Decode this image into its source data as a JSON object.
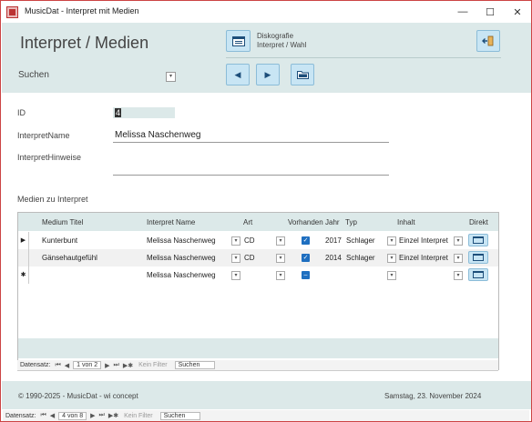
{
  "window": {
    "title": "MusicDat - Interpret mit Medien",
    "min_glyph": "—",
    "max_glyph": "☐",
    "close_glyph": "✕"
  },
  "header": {
    "title": "Interpret / Medien",
    "search_label": "Suchen",
    "disco_line1": "Diskografie",
    "disco_line2": "Interpret / Wahl"
  },
  "form": {
    "id_label": "ID",
    "id_value": "4",
    "name_label": "InterpretName",
    "name_value": "Melissa Naschenweg",
    "hint_label": "InterpretHinweise",
    "hint_value": "",
    "media_label": "Medien zu Interpret"
  },
  "subform": {
    "columns": [
      "Medium Titel",
      "Interpret Name",
      "Art",
      "Vorhanden",
      "Jahr",
      "Typ",
      "Inhalt",
      "Direkt"
    ],
    "rows": [
      {
        "selector": "▶",
        "titel": "Kunterbunt",
        "interpret": "Melissa Naschenweg",
        "art": "CD",
        "vorhanden": true,
        "jahr": "2017",
        "typ": "Schlager",
        "inhalt": "Einzel Interpret"
      },
      {
        "selector": "",
        "titel": "Gänsehautgefühl",
        "interpret": "Melissa Naschenweg",
        "art": "CD",
        "vorhanden": true,
        "jahr": "2014",
        "typ": "Schlager",
        "inhalt": "Einzel Interpret"
      },
      {
        "selector": "✱",
        "titel": "",
        "interpret": "Melissa Naschenweg",
        "art": "",
        "vorhanden": false,
        "jahr": "",
        "typ": "",
        "inhalt": ""
      }
    ],
    "nav": {
      "label": "Datensatz:",
      "record": "1 von 2",
      "filter": "Kein Filter",
      "search": "Suchen"
    }
  },
  "footer": {
    "copyright": "© 1990-2025 - MusicDat - wi concept",
    "date": "Samstag, 23. November 2024"
  },
  "main_nav": {
    "label": "Datensatz:",
    "record": "4 von 8",
    "filter": "Kein Filter",
    "search": "Suchen"
  },
  "colors": {
    "accent_band": "#dce9e9",
    "button_fill": "#c8e5f4",
    "checkbox": "#1f6fc0",
    "window_border": "#cc4444"
  },
  "icons": {
    "first": "⏮",
    "prev": "◀",
    "next": "▶",
    "last": "⏭",
    "new": "▶✱"
  }
}
